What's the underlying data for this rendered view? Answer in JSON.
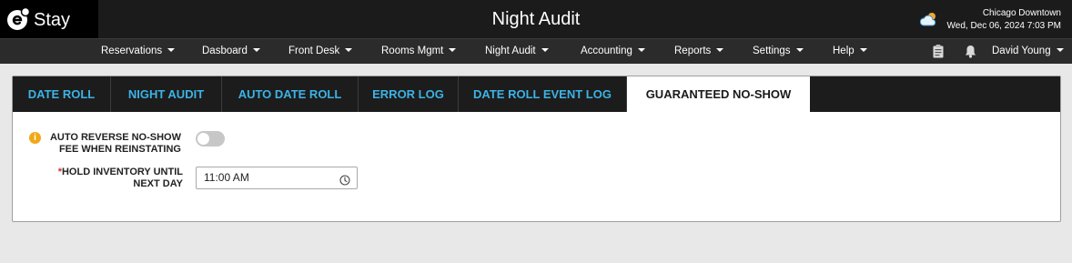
{
  "app": {
    "brand": "Stay",
    "title": "Night Audit"
  },
  "header": {
    "location": "Chicago Downtown",
    "datetime": "Wed, Dec 06, 2024 7:03 PM",
    "weather_icon": "cloud-sun-icon"
  },
  "nav": {
    "items": [
      {
        "label": "Reservations"
      },
      {
        "label": "Dasboard"
      },
      {
        "label": "Front Desk"
      },
      {
        "label": "Rooms Mgmt"
      },
      {
        "label": "Night Audit"
      },
      {
        "label": "Accounting"
      },
      {
        "label": "Reports"
      },
      {
        "label": "Settings"
      },
      {
        "label": "Help"
      }
    ],
    "user": "David Young"
  },
  "tabs": [
    {
      "label": "DATE ROLL"
    },
    {
      "label": "NIGHT AUDIT"
    },
    {
      "label": "AUTO DATE ROLL"
    },
    {
      "label": "ERROR LOG"
    },
    {
      "label": "DATE ROLL EVENT LOG"
    },
    {
      "label": "GUARANTEED NO-SHOW",
      "active": true
    }
  ],
  "form": {
    "auto_reverse": {
      "line1": "AUTO REVERSE NO-SHOW",
      "line2": "FEE WHEN REINSTATING",
      "enabled": false,
      "info_icon": "i"
    },
    "hold_inventory": {
      "required_mark": "*",
      "line1": "HOLD INVENTORY UNTIL",
      "line2": "NEXT DAY",
      "value": "11:00 AM"
    }
  },
  "colors": {
    "accent": "#3cb3e6",
    "info": "#f0a81a",
    "required": "#d0312d"
  }
}
